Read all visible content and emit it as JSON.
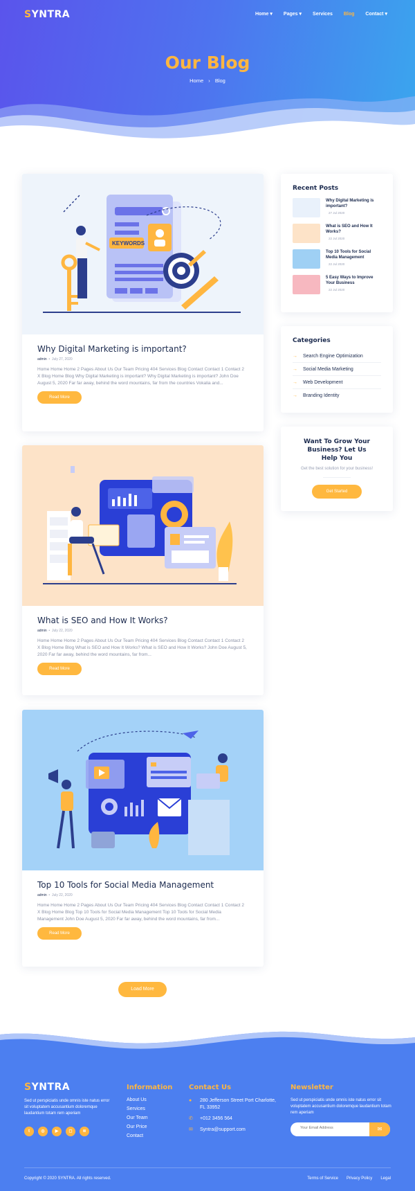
{
  "brand": {
    "name_first": "S",
    "name_rest": "YNTRA"
  },
  "nav": {
    "items": [
      {
        "label": "Home",
        "caret": "▾"
      },
      {
        "label": "Pages",
        "caret": "▾"
      },
      {
        "label": "Services",
        "caret": ""
      },
      {
        "label": "Blog",
        "caret": ""
      },
      {
        "label": "Contact",
        "caret": "▾"
      }
    ],
    "active": "Blog"
  },
  "hero": {
    "title": "Our Blog",
    "breadcrumb_home": "Home",
    "breadcrumb_sep": "›",
    "breadcrumb_current": "Blog"
  },
  "posts": [
    {
      "title": "Why Digital Marketing is important?",
      "author": "admin",
      "date": "July 27, 2020",
      "excerpt": "Home Home Home 2 Pages About Us Our Team Pricing 404 Services Blog Contact Contact 1 Contact 2 X Blog Home Blog Why Digital Marketing is important? Why Digital Marketing is important? John Doe August 5, 2020 Far far away, behind the word mountains, far from the countries Vokalia and...",
      "button": "Read More",
      "illustration_badge": "KEYWORDS"
    },
    {
      "title": "What is SEO and How It Works?",
      "author": "admin",
      "date": "July 22, 2020",
      "excerpt": "Home Home Home 2 Pages About Us Our Team Pricing 404 Services Blog Contact Contact 1 Contact 2 X Blog Home Blog What is SEO and How It Works? What is SEO and How It Works? John Doe August 5, 2020 Far far away, behind the word mountains, far from...",
      "button": "Read More"
    },
    {
      "title": "Top 10 Tools for Social Media Management",
      "author": "admin",
      "date": "July 22, 2020",
      "excerpt": "Home Home Home 2 Pages About Us Our Team Pricing 404 Services Blog Contact Contact 1 Contact 2 X Blog Home Blog Top 10 Tools for Social Media Management Top 10 Tools for Social Media Management John Doe August 5, 2020 Far far away, behind the word mountains, far from...",
      "button": "Read More"
    }
  ],
  "load_more": "Load More",
  "sidebar": {
    "recent_title": "Recent Posts",
    "recent": [
      {
        "title": "Why Digital Marketing is important?",
        "date": "27 Jul 2020",
        "thumb_color": "#e9f1fb"
      },
      {
        "title": "What is SEO and How It Works?",
        "date": "22 Jul 2020",
        "thumb_color": "#fde3c8"
      },
      {
        "title": "Top 10 Tools for Social Media Management",
        "date": "22 Jul 2020",
        "thumb_color": "#9fd0f4"
      },
      {
        "title": "5 Easy Ways to Improve Your Business",
        "date": "22 Jul 2020",
        "thumb_color": "#f7b8c0"
      }
    ],
    "categories_title": "Categories",
    "categories": [
      "Search Engine Optimization",
      "Social Media Marketing",
      "Web Development",
      "Branding Identity"
    ],
    "cta_title": "Want To Grow Your Business? Let Us Help You",
    "cta_text": "Get the best solution for your business!",
    "cta_button": "Get Started"
  },
  "footer": {
    "about": "Sed ut perspiciatis unde omnis iste natus error sit voluptatem accusantium doloremque laudantium totam rem aperiam",
    "social": [
      "twitter-icon",
      "dribbble-icon",
      "youtube-icon",
      "instagram-icon",
      "rss-icon"
    ],
    "info_title": "Information",
    "info_links": [
      "About Us",
      "Services",
      "Our Team",
      "Our Price",
      "Contact"
    ],
    "contact_title": "Contact Us",
    "address": "280 Jefferson Street Port Charlotte, FL 33952",
    "phone": "+012 3456 564",
    "email": "Syntra@support.com",
    "newsletter_title": "Newsletter",
    "newsletter_text": "Sed ut perspiciatis unde omnis iste natus error sit voluptatem accusantium doloremque laudantium totam rem aperiam",
    "newsletter_placeholder": "Your Email Address",
    "copyright": "Copyright © 2020 SYNTRA. All rights reserved.",
    "bottom_links": [
      "Terms of Service",
      "Privacy Policy",
      "Legal"
    ]
  },
  "colors": {
    "accent": "#ffb640",
    "primary": "#5a54ec",
    "dark": "#1b2a4e",
    "footer": "#4c7ff0"
  }
}
